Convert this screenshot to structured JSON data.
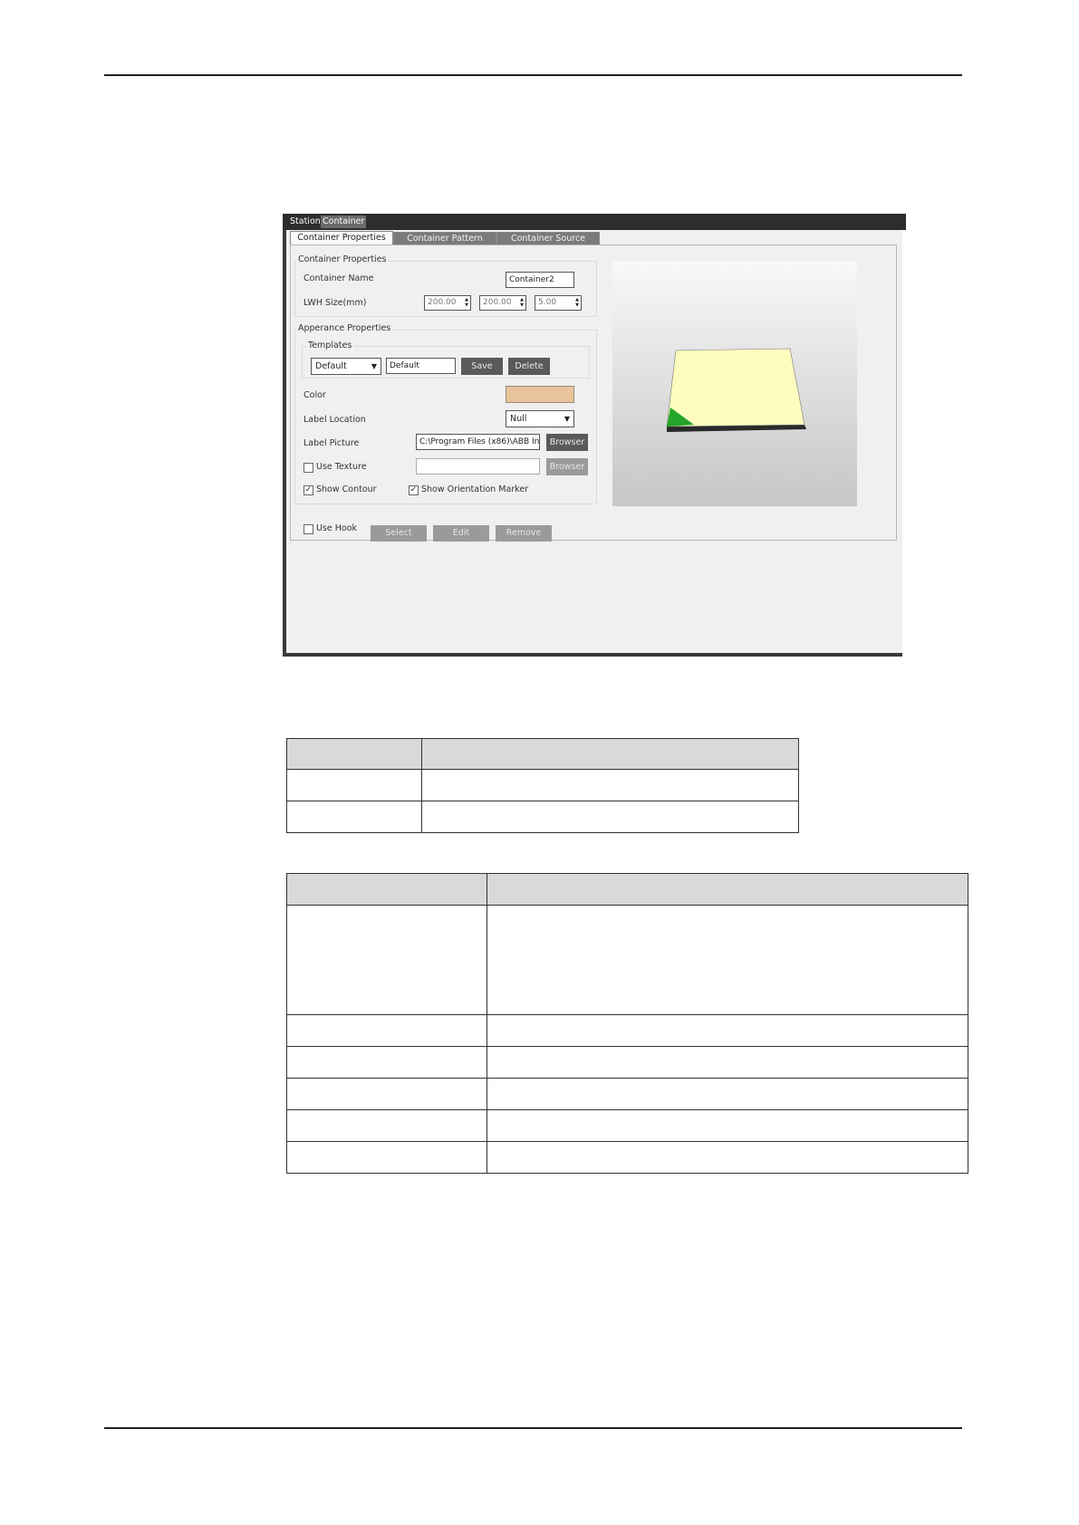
{
  "window": {
    "top_tabs": [
      "Station",
      "Container"
    ],
    "tabs": [
      "Container Properties",
      "Container Pattern",
      "Container Source"
    ],
    "container_properties": {
      "group_title": "Container Properties",
      "name_label": "Container Name",
      "name_value": "Container2",
      "lwh_label": "LWH Size(mm)",
      "length": "200.00",
      "width": "200.00",
      "height": "5.00"
    },
    "appearance": {
      "group_title": "Apperance Properties",
      "templates_label": "Templates",
      "template_select": "Default",
      "template_name": "Default",
      "save_label": "Save",
      "delete_label": "Delete",
      "color_label": "Color",
      "color_value": "#e9c49b",
      "label_location_label": "Label Location",
      "label_location_value": "Null",
      "label_picture_label": "Label Picture",
      "label_picture_path": "C:\\Program Files (x86)\\ABB Indus",
      "browser_label": "Browser",
      "use_texture_label": "Use Texture",
      "use_texture_checked": false,
      "texture_browser_label": "Browser",
      "show_contour_label": "Show Contour",
      "show_contour_checked": true,
      "show_orientation_label": "Show Orientation Marker",
      "show_orientation_checked": true
    },
    "hook": {
      "use_hook_label": "Use Hook",
      "use_hook_checked": false,
      "select_label": "Select",
      "edit_label": "Edit",
      "remove_label": "Remove"
    },
    "preview_colors": {
      "top": "#fefdc0",
      "side": "#2a2a2a",
      "marker": "#25a52a"
    }
  },
  "table1": {
    "rows": 3,
    "cols": 2
  },
  "table2": {
    "rows": 7,
    "cols": 2
  }
}
